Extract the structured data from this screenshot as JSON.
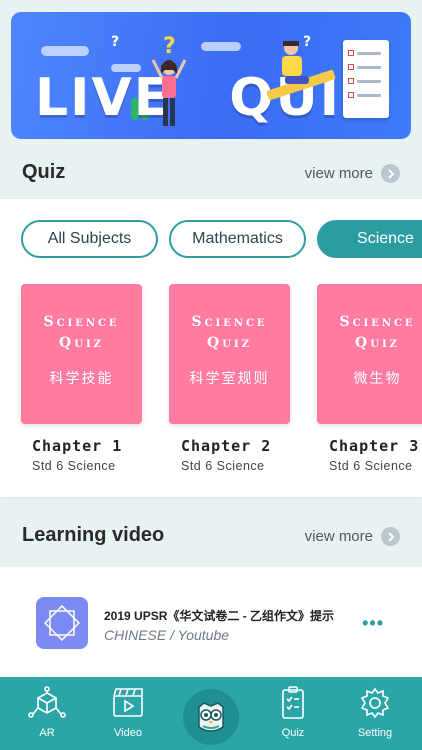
{
  "banner": {
    "title_word1": "LIVE",
    "title_word2": "QUIZ"
  },
  "quiz_section": {
    "title": "Quiz",
    "view_more": "view more",
    "filters": [
      {
        "label": "All Subjects",
        "active": false
      },
      {
        "label": "Mathematics",
        "active": false
      },
      {
        "label": "Science",
        "active": true
      }
    ],
    "cards": [
      {
        "cover_line1": "Science",
        "cover_line2": "Quiz",
        "cover_sub": "科学技能",
        "chapter": "Chapter 1",
        "grade": "Std 6 Science"
      },
      {
        "cover_line1": "Science",
        "cover_line2": "Quiz",
        "cover_sub": "科学室规则",
        "chapter": "Chapter 2",
        "grade": "Std 6 Science"
      },
      {
        "cover_line1": "Science",
        "cover_line2": "Quiz",
        "cover_sub": "微生物",
        "chapter": "Chapter 3",
        "grade": "Std 6 Science"
      }
    ]
  },
  "video_section": {
    "title": "Learning video",
    "view_more": "view more",
    "item": {
      "title": "2019 UPSR《华文试卷二 - 乙组作文》提示",
      "subtitle": "CHINESE / Youtube",
      "more": "•••"
    }
  },
  "bottom_nav": {
    "items": [
      {
        "label": "AR",
        "icon": "ar-cube-icon"
      },
      {
        "label": "Video",
        "icon": "video-clapper-icon"
      },
      {
        "label": "",
        "icon": "owl-home-icon"
      },
      {
        "label": "Quiz",
        "icon": "quiz-clipboard-icon"
      },
      {
        "label": "Setting",
        "icon": "gear-icon"
      }
    ]
  },
  "colors": {
    "accent": "#2ba5a8",
    "card_pink": "#ff7ba0",
    "banner_blue": "#3b6cf4"
  }
}
